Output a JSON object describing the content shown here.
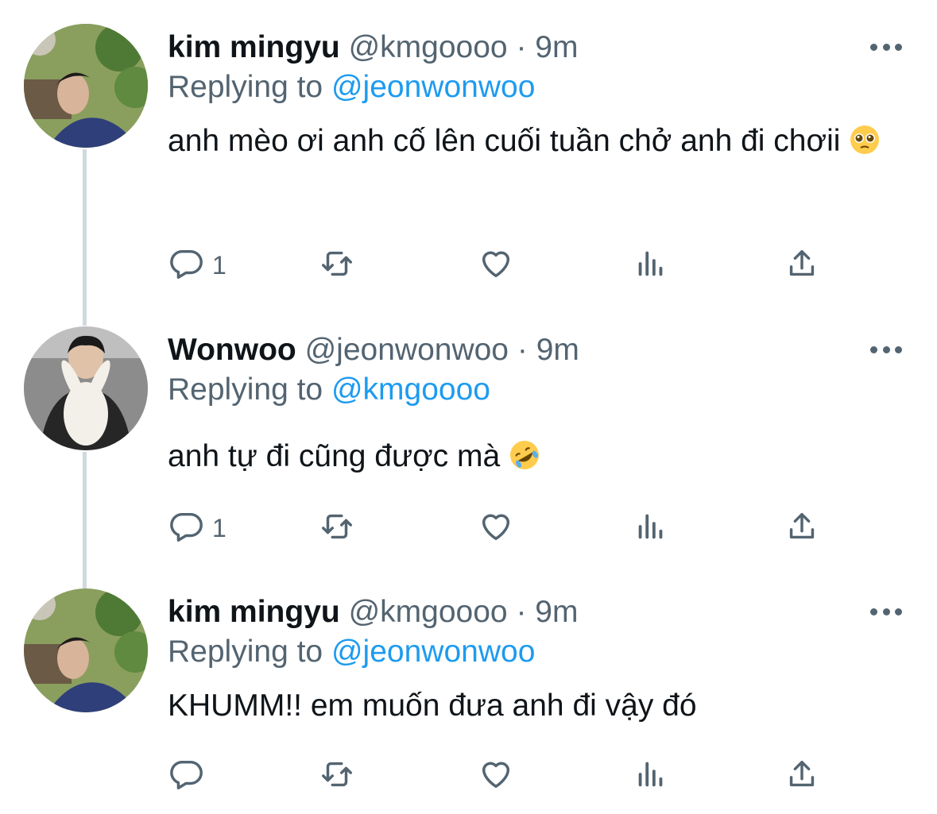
{
  "tweets": [
    {
      "name": "kim mingyu",
      "handle": "@kmgoooo",
      "dot": "·",
      "time": "9m",
      "replying_prefix": "Replying to",
      "replying_to": "@jeonwonwoo",
      "text": "anh mèo ơi anh cố lên cuối tuần chở anh đi chơii",
      "emoji": "pleading-face-emoji",
      "reply_count": "1",
      "avatar": "avatar-kim-mingyu"
    },
    {
      "name": "Wonwoo",
      "handle": "@jeonwonwoo",
      "dot": "·",
      "time": "9m",
      "replying_prefix": "Replying to",
      "replying_to": "@kmgoooo",
      "text": "anh tự đi cũng được mà",
      "emoji": "rolling-on-floor-laughing-emoji",
      "reply_count": "1",
      "avatar": "avatar-wonwoo"
    },
    {
      "name": "kim mingyu",
      "handle": "@kmgoooo",
      "dot": "·",
      "time": "9m",
      "replying_prefix": "Replying to",
      "replying_to": "@jeonwonwoo",
      "text": "KHUMM!! em muốn đưa anh đi vậy đó",
      "reply_count": "",
      "avatar": "avatar-kim-mingyu"
    }
  ],
  "icons": [
    "reply-icon",
    "retweet-icon",
    "like-icon",
    "analytics-icon",
    "share-icon",
    "more-icon"
  ],
  "colors": {
    "link": "#1d9bf0",
    "secondary": "#536471",
    "text": "#0f1419",
    "thread_line": "#cfd9de"
  }
}
